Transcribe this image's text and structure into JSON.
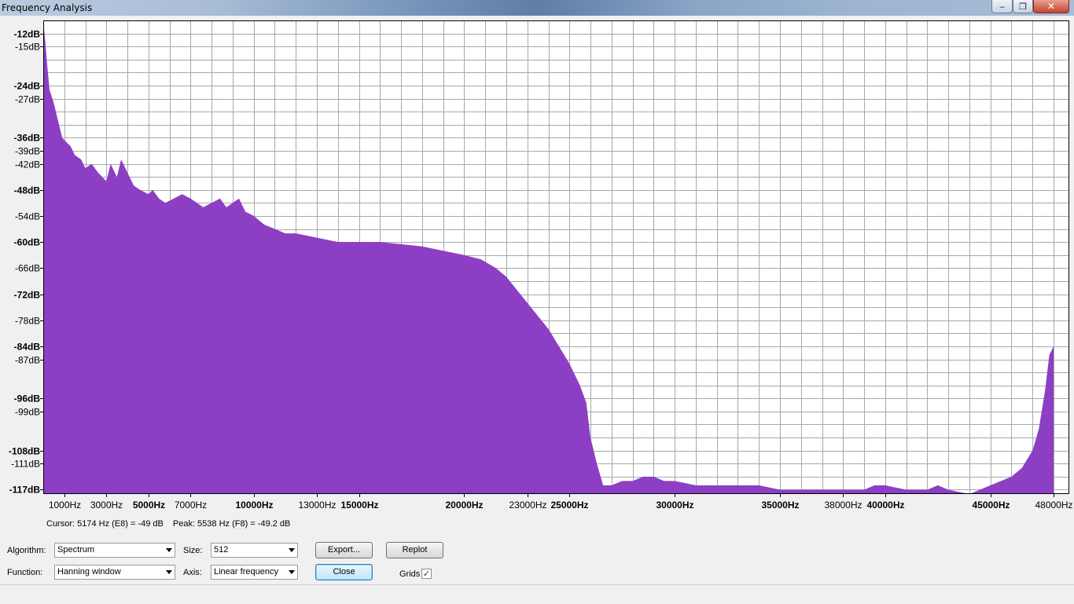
{
  "window": {
    "title": "Frequency Analysis",
    "min_glyph": "‒",
    "max_glyph": "❐",
    "close_glyph": "✕"
  },
  "chart_data": {
    "type": "area",
    "title": "",
    "xlabel": "",
    "ylabel": "",
    "xlim": [
      0,
      48000
    ],
    "ylim": [
      -118,
      -9
    ],
    "grid": true,
    "fill_color": "#8c3fc4",
    "y_ticks": [
      {
        "value": -12,
        "label": "-12dB",
        "major": true
      },
      {
        "value": -15,
        "label": "-15dB",
        "major": false
      },
      {
        "value": -24,
        "label": "-24dB",
        "major": true
      },
      {
        "value": -27,
        "label": "-27dB",
        "major": false
      },
      {
        "value": -36,
        "label": "-36dB",
        "major": true
      },
      {
        "value": -39,
        "label": "-39dB",
        "major": false
      },
      {
        "value": -42,
        "label": "-42dB",
        "major": false
      },
      {
        "value": -48,
        "label": "-48dB",
        "major": true
      },
      {
        "value": -54,
        "label": "-54dB",
        "major": false
      },
      {
        "value": -60,
        "label": "-60dB",
        "major": true
      },
      {
        "value": -66,
        "label": "-66dB",
        "major": false
      },
      {
        "value": -72,
        "label": "-72dB",
        "major": true
      },
      {
        "value": -78,
        "label": "-78dB",
        "major": false
      },
      {
        "value": -84,
        "label": "-84dB",
        "major": true
      },
      {
        "value": -87,
        "label": "-87dB",
        "major": false
      },
      {
        "value": -96,
        "label": "-96dB",
        "major": true
      },
      {
        "value": -99,
        "label": "-99dB",
        "major": false
      },
      {
        "value": -108,
        "label": "-108dB",
        "major": true
      },
      {
        "value": -111,
        "label": "-111dB",
        "major": false
      },
      {
        "value": -117,
        "label": "-117dB",
        "major": true
      }
    ],
    "x_ticks": [
      {
        "value": 1000,
        "label": "1000Hz",
        "major": false
      },
      {
        "value": 3000,
        "label": "3000Hz",
        "major": false
      },
      {
        "value": 5000,
        "label": "5000Hz",
        "major": true
      },
      {
        "value": 7000,
        "label": "7000Hz",
        "major": false
      },
      {
        "value": 10000,
        "label": "10000Hz",
        "major": true
      },
      {
        "value": 13000,
        "label": "13000Hz",
        "major": false
      },
      {
        "value": 15000,
        "label": "15000Hz",
        "major": true
      },
      {
        "value": 20000,
        "label": "20000Hz",
        "major": true
      },
      {
        "value": 23000,
        "label": "23000Hz",
        "major": false
      },
      {
        "value": 25000,
        "label": "25000Hz",
        "major": true
      },
      {
        "value": 30000,
        "label": "30000Hz",
        "major": true
      },
      {
        "value": 35000,
        "label": "35000Hz",
        "major": true
      },
      {
        "value": 38000,
        "label": "38000Hz",
        "major": false
      },
      {
        "value": 40000,
        "label": "40000Hz",
        "major": true
      },
      {
        "value": 45000,
        "label": "45000Hz",
        "major": true
      },
      {
        "value": 48000,
        "label": "48000Hz",
        "major": false
      }
    ],
    "x_minor_step": 1000,
    "y_minor_step": 3,
    "series": [
      {
        "x": [
          0,
          100,
          200,
          300,
          500,
          700,
          900,
          1100,
          1300,
          1500,
          1800,
          2000,
          2300,
          2600,
          3000,
          3200,
          3500,
          3700,
          4000,
          4300,
          4600,
          5000,
          5200,
          5500,
          5800,
          6200,
          6600,
          7000,
          7300,
          7600,
          8000,
          8400,
          8700,
          9000,
          9300,
          9600,
          10000,
          10500,
          11000,
          11500,
          12000,
          13000,
          14000,
          15000,
          16000,
          17000,
          18000,
          19000,
          20000,
          20800,
          21500,
          22000,
          22500,
          23000,
          23500,
          24000,
          24500,
          25000,
          25500,
          25800,
          26000,
          26300,
          26600,
          27000,
          27500,
          28000,
          28500,
          29000,
          29500,
          30000,
          31000,
          32000,
          33000,
          34000,
          35000,
          36000,
          37000,
          38000,
          39000,
          39500,
          40000,
          41000,
          42000,
          42500,
          43000,
          44000,
          44500,
          45000,
          45500,
          46000,
          46500,
          47000,
          47300,
          47600,
          47800,
          48000
        ],
        "y": [
          -9,
          -14,
          -20,
          -25,
          -28,
          -32,
          -36,
          -37,
          -38,
          -40,
          -41,
          -43,
          -42,
          -44,
          -46,
          -42,
          -45,
          -41,
          -44,
          -47,
          -48,
          -49,
          -48,
          -50,
          -51,
          -50,
          -49,
          -50,
          -51,
          -52,
          -51,
          -50,
          -52,
          -51,
          -50,
          -53,
          -54,
          -56,
          -57,
          -58,
          -58,
          -59,
          -60,
          -60,
          -60,
          -60.5,
          -61,
          -62,
          -63,
          -64,
          -66,
          -68,
          -71,
          -74,
          -77,
          -80,
          -84,
          -88,
          -93,
          -97,
          -105,
          -111,
          -116,
          -116,
          -115,
          -115,
          -114,
          -114,
          -115,
          -115,
          -116,
          -116,
          -116,
          -116,
          -117,
          -117,
          -117,
          -117,
          -117,
          -116,
          -116,
          -117,
          -117,
          -116,
          -117,
          -118,
          -117,
          -116,
          -115,
          -114,
          -112,
          -108,
          -103,
          -94,
          -86,
          -84
        ]
      }
    ]
  },
  "status": {
    "cursor": "Cursor: 5174 Hz (E8) = -49 dB",
    "peak": "Peak: 5538 Hz (F8) = -49.2 dB"
  },
  "controls": {
    "algorithm_label": "Algorithm:",
    "algorithm_value": "Spectrum",
    "size_label": "Size:",
    "size_value": "512",
    "function_label": "Function:",
    "function_value": "Hanning window",
    "axis_label": "Axis:",
    "axis_value": "Linear frequency",
    "export_label": "Export...",
    "replot_label": "Replot",
    "close_label": "Close",
    "grids_label": "Grids",
    "grids_checked": "✓"
  }
}
